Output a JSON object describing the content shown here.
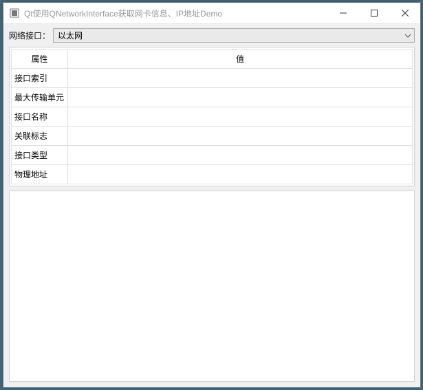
{
  "window": {
    "title": "Qt使用QNetworkInterface获取网卡信息、IP地址Demo"
  },
  "iface": {
    "label": "网络接口：",
    "selected": "以太网"
  },
  "table": {
    "headers": {
      "attr": "属性",
      "value": "值"
    },
    "rows": [
      {
        "attr": "接口索引",
        "value": ""
      },
      {
        "attr": "最大传输单元",
        "value": ""
      },
      {
        "attr": "接口名称",
        "value": ""
      },
      {
        "attr": "关联标志",
        "value": ""
      },
      {
        "attr": "接口类型",
        "value": ""
      },
      {
        "attr": "物理地址",
        "value": ""
      }
    ]
  },
  "log": ""
}
